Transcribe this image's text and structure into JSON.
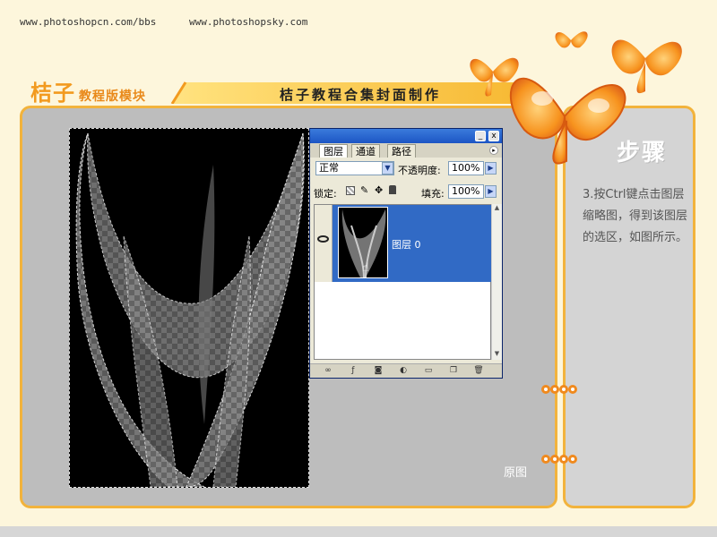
{
  "header": {
    "links": [
      "www.photoshopcn.com/bbs",
      "www.photoshopsky.com"
    ],
    "brand": "桔子",
    "brand_sub": "教程版模块",
    "title": "桔子教程合集封面制作"
  },
  "side": {
    "title": "步骤",
    "step_text": "3.按Ctrl键点击图层缩略图，得到该图层的选区，如图所示。"
  },
  "caption": "原图",
  "ps_panel": {
    "tabs": [
      "图层",
      "通道",
      "路径"
    ],
    "blend_mode": "正常",
    "opacity_label": "不透明度:",
    "opacity_value": "100%",
    "lock_label": "锁定:",
    "fill_label": "填充:",
    "fill_value": "100%",
    "layer_name": "图层 0",
    "titlebar_buttons": [
      "_",
      "x"
    ]
  },
  "colors": {
    "accent": "#f2b33c",
    "orange": "#f08a1e",
    "panel_grey": "#bdbdbd",
    "selection_blue": "#316ac5"
  }
}
